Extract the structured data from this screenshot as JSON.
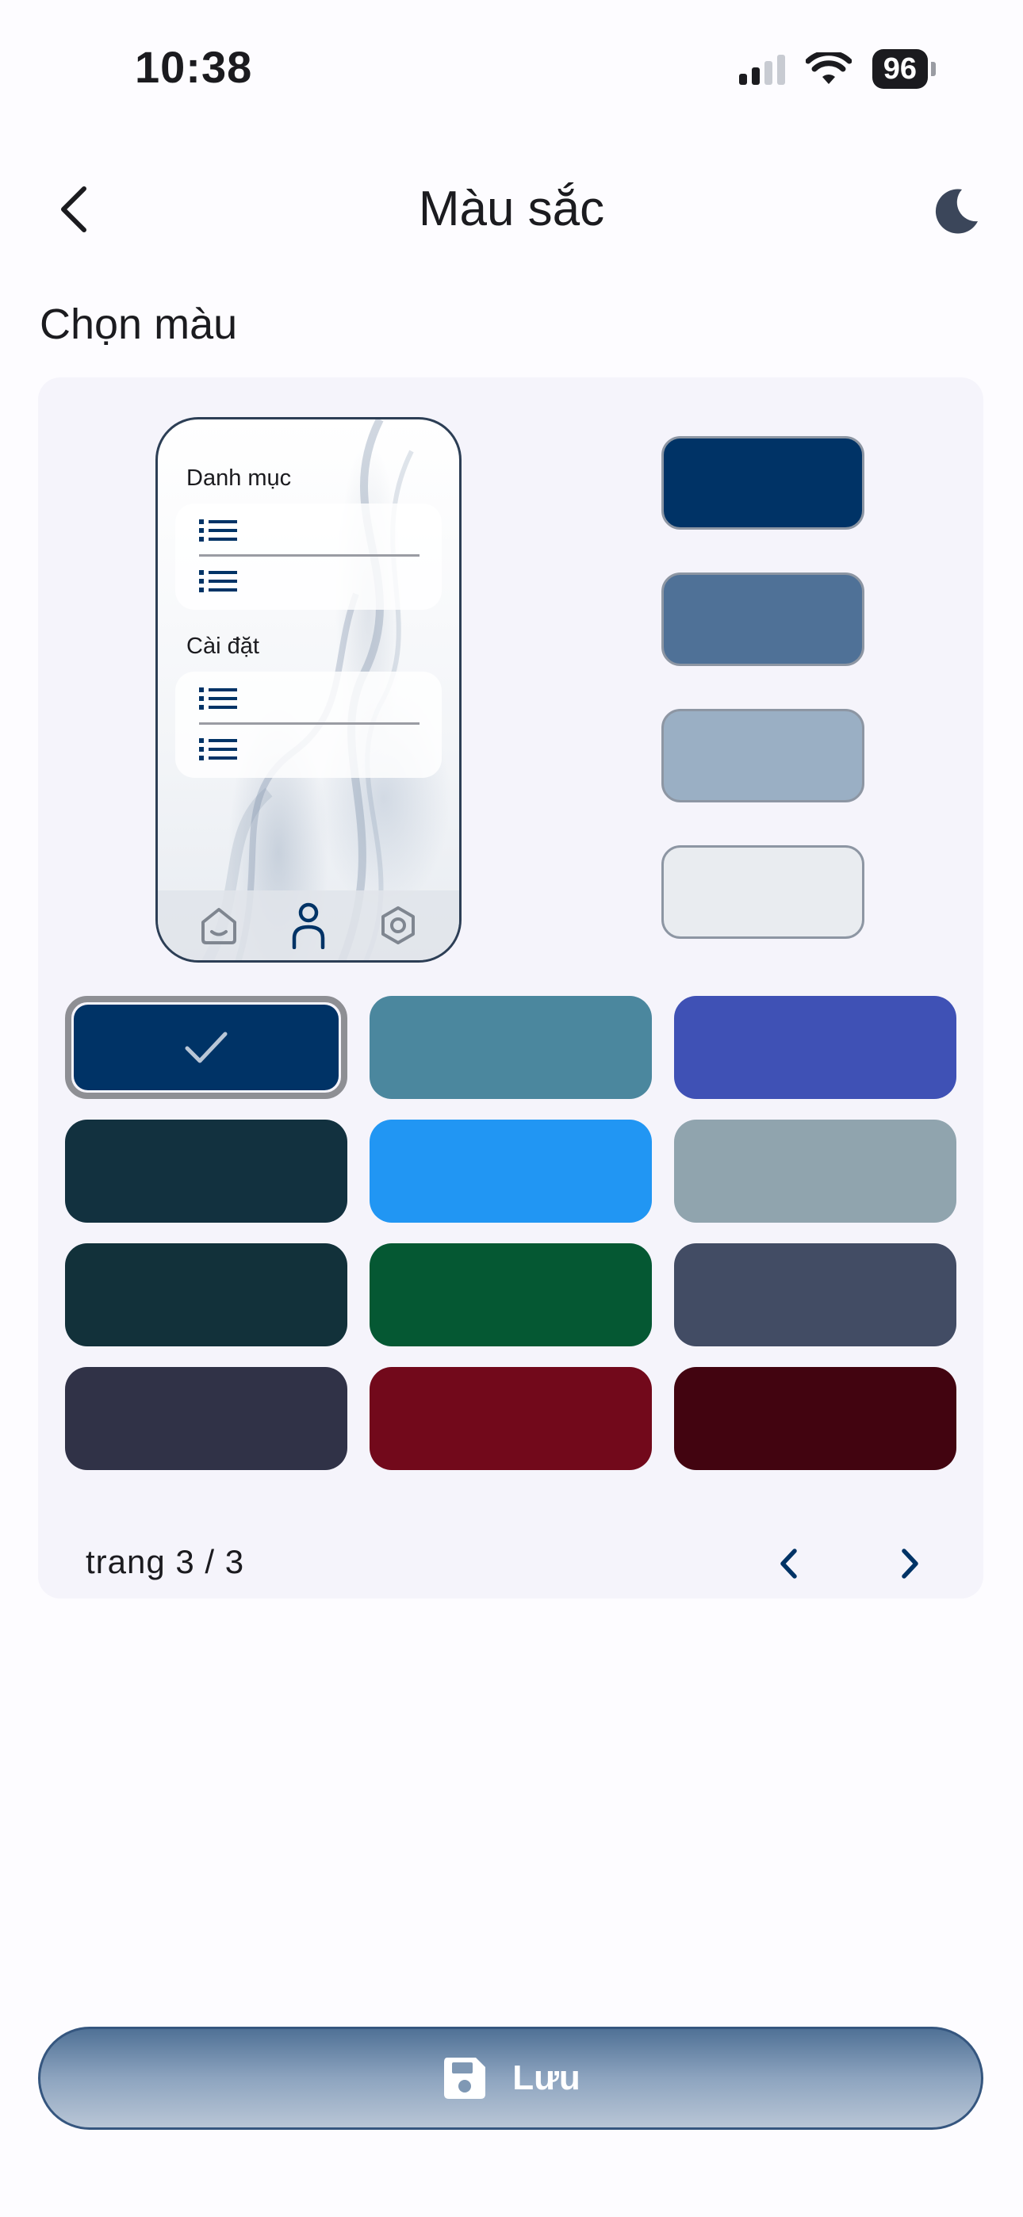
{
  "status_bar": {
    "time": "10:38",
    "battery": "96"
  },
  "app_bar": {
    "title": "Màu sắc"
  },
  "section_title": "Chọn màu",
  "preview": {
    "group1_label": "Danh mục",
    "group2_label": "Cài đặt",
    "shade_swatches": [
      "#003366",
      "#4f7197",
      "#9aafc4",
      "#e9ecf0"
    ]
  },
  "colors": [
    {
      "name": "navy",
      "hex": "#003366",
      "selected": true
    },
    {
      "name": "teal-blue",
      "hex": "#4b879e",
      "selected": false
    },
    {
      "name": "indigo",
      "hex": "#3f51b5",
      "selected": false
    },
    {
      "name": "dark-slate-teal",
      "hex": "#12313f",
      "selected": false
    },
    {
      "name": "bright-blue",
      "hex": "#2196f3",
      "selected": false
    },
    {
      "name": "gray-blue",
      "hex": "#90a4ae",
      "selected": false
    },
    {
      "name": "deep-teal",
      "hex": "#12313a",
      "selected": false
    },
    {
      "name": "forest-green",
      "hex": "#055833",
      "selected": false
    },
    {
      "name": "slate",
      "hex": "#424c64",
      "selected": false
    },
    {
      "name": "charcoal-navy",
      "hex": "#303247",
      "selected": false
    },
    {
      "name": "crimson",
      "hex": "#72091b",
      "selected": false
    },
    {
      "name": "maroon",
      "hex": "#420410",
      "selected": false
    }
  ],
  "pager": {
    "text": "trang 3 / 3"
  },
  "save_button": {
    "label": "Lưu"
  },
  "accent": "#003366"
}
